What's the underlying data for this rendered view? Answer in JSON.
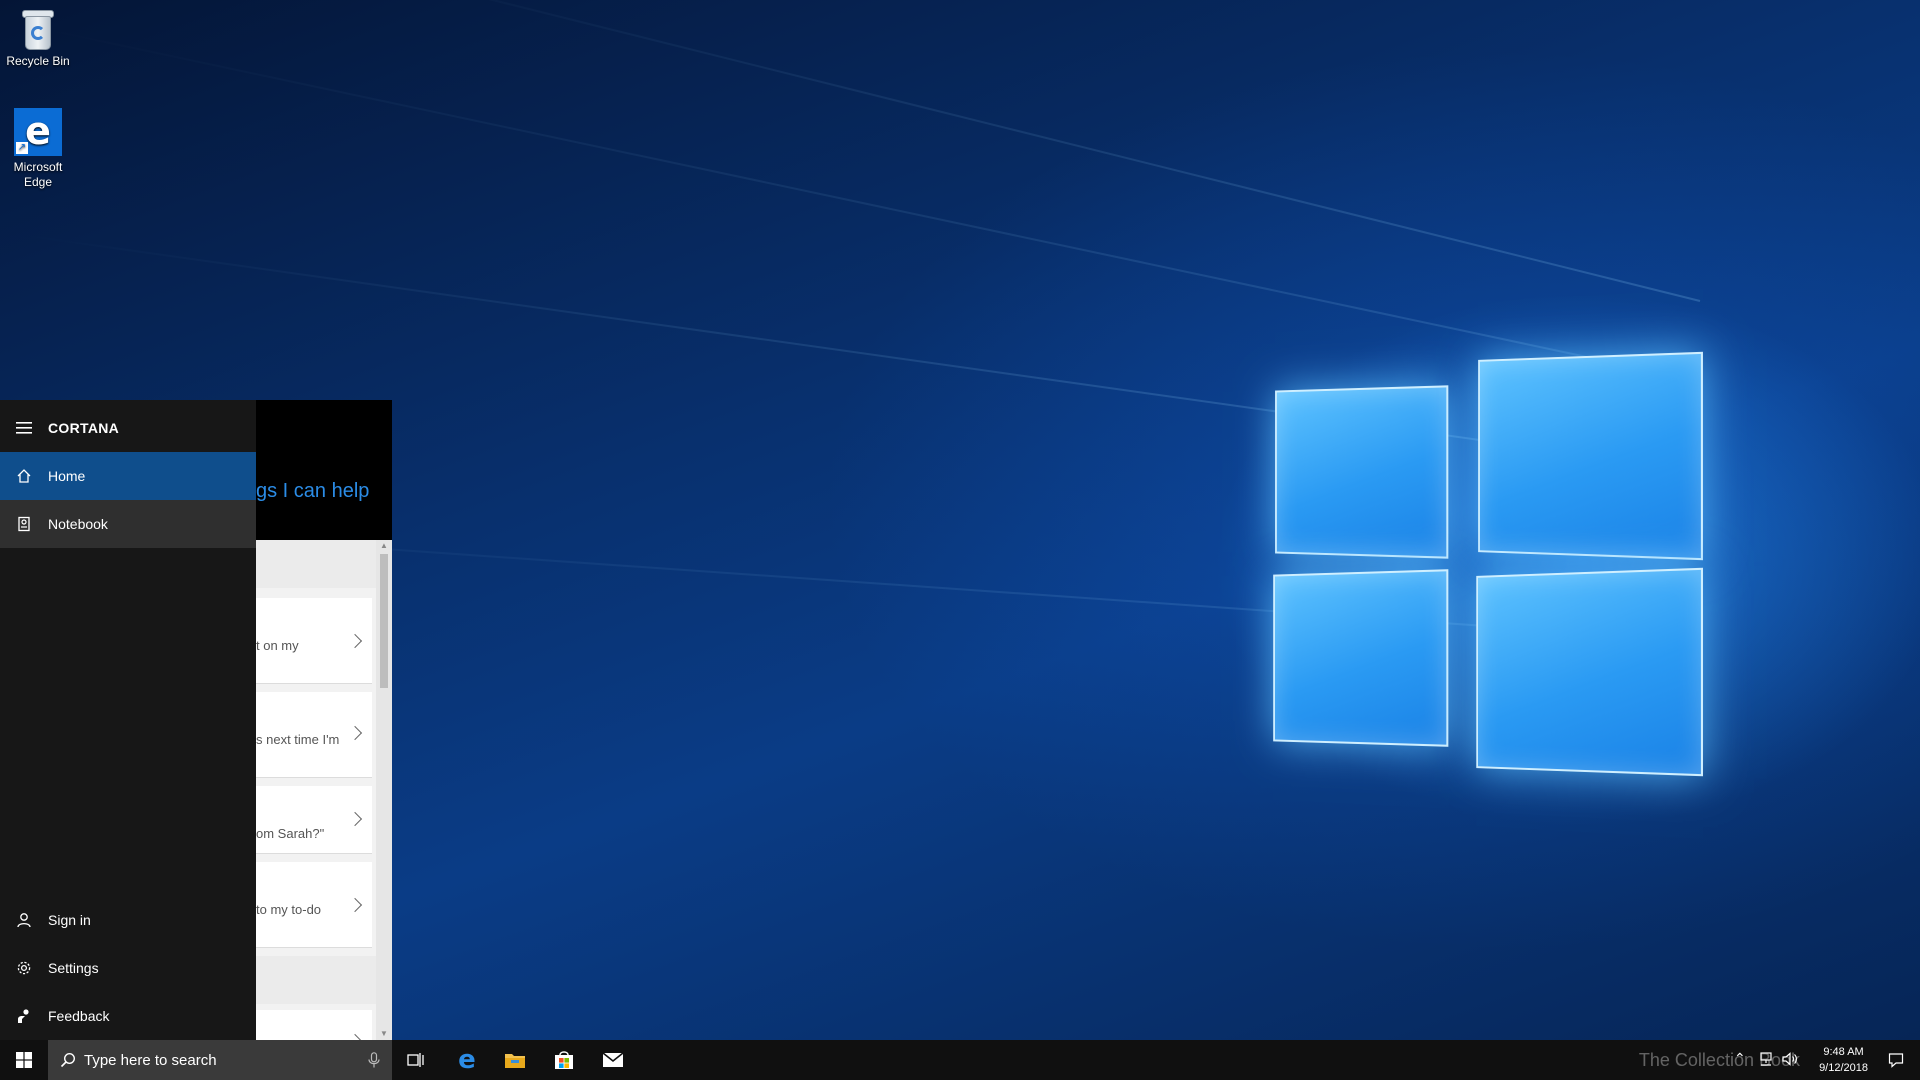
{
  "desktop": {
    "icons": [
      {
        "label": "Recycle Bin"
      },
      {
        "label": "Microsoft Edge"
      }
    ]
  },
  "cortana": {
    "title": "CORTANA",
    "nav": {
      "home": "Home",
      "notebook": "Notebook",
      "sign_in": "Sign in",
      "settings": "Settings",
      "feedback": "Feedback"
    },
    "header_partial": "gs I can help",
    "cards": [
      {
        "text": "t on my"
      },
      {
        "text": "s next time I'm"
      },
      {
        "text": "om Sarah?\""
      },
      {
        "text": "to my to-do"
      }
    ]
  },
  "taskbar": {
    "search_placeholder": "Type here to search",
    "pinned": [
      "task-view",
      "microsoft-edge",
      "file-explorer",
      "microsoft-store",
      "mail"
    ],
    "clock_time": "9:48 AM",
    "clock_date": "9/12/2018",
    "watermark": "The Collection Book"
  },
  "colors": {
    "accent": "#0f4e8c",
    "cortana_link": "#2b8ce6",
    "taskbar": "#101010"
  }
}
